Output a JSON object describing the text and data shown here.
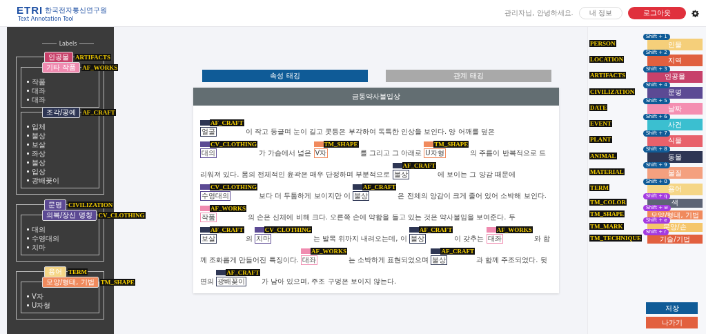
{
  "header": {
    "logo": "ETRI",
    "logo_sub": "한국전자통신연구원",
    "app_name": "Text Annotation Tool",
    "greeting": "관리자님, 안녕하세요.",
    "buttons": [
      {
        "label": "내 정보",
        "kind": "outline"
      },
      {
        "label": "로그아웃",
        "kind": "danger"
      }
    ]
  },
  "sidebar": {
    "heading": "Labels",
    "groups": [
      {
        "label": "인공물",
        "tag": "ARTIFACTS",
        "color": "#c7416a",
        "children": [
          {
            "label": "기타 작품",
            "tag": "AF_WORKS",
            "color": "#f08bb0",
            "items": [
              "작품",
              "대좌",
              "대좌"
            ]
          },
          {
            "label": "조각/공예",
            "tag": "AF_CRAFT",
            "color": "#2e3654",
            "items": [
              "입체",
              "불상",
              "보살",
              "좌상",
              "불상",
              "입상",
              "광배꽂이"
            ]
          }
        ]
      },
      {
        "label": "문명",
        "tag": "CIVILIZATION",
        "color": "#5c4a94",
        "children": [
          {
            "label": "의복/장신 명칭",
            "tag": "CV_CLOTHING",
            "color": "#5c4a94",
            "items": [
              "대의",
              "수영대의",
              "치마"
            ]
          }
        ]
      },
      {
        "label": "용어",
        "tag": "TERM",
        "color": "#f5d687",
        "children": [
          {
            "label": "모양/형태, 기법",
            "tag": "TM_SHAPE",
            "color": "#f08a5d",
            "items": [
              "V자",
              "U자형"
            ]
          }
        ]
      }
    ]
  },
  "tabs": [
    {
      "label": "속성 태깅",
      "selected": true
    },
    {
      "label": "관계 태깅",
      "selected": false
    }
  ],
  "document": {
    "title": "금동약사불입상",
    "segments": [
      {
        "text": "얼굴",
        "tag": "AF_CRAFT",
        "color": "#2e3654"
      },
      {
        "text": "이 작고 둥글며 눈이 길고 콧등은 부각하여 독특한 인상을 보인다. 양 어깨를 덮은 "
      },
      {
        "text": "대의",
        "tag": "CV_CLOTHING",
        "color": "#5c4a94"
      },
      {
        "text": "가 가슴에서 넓은 "
      },
      {
        "text": "V자",
        "tag": "TM_SHAPE",
        "color": "#f08a5d"
      },
      {
        "text": "를 그리고 그 아래로 "
      },
      {
        "text": "U자형",
        "tag": "TM_SHAPE",
        "color": "#f08a5d"
      },
      {
        "text": "의 주름이 반복적으로 드리워져 있다. 몸의 전체적인 윤곽은 매우 단정하며 부분적으로 "
      },
      {
        "text": "불상",
        "tag": "AF_CRAFT",
        "color": "#2e3654"
      },
      {
        "text": "에 보이는 그 양감 때문에 "
      },
      {
        "text": "수영대의",
        "tag": "CV_CLOTHING",
        "color": "#5c4a94"
      },
      {
        "text": "보다 더 두툼하게 보이지만 이 "
      },
      {
        "text": "불상",
        "tag": "AF_CRAFT",
        "color": "#2e3654"
      },
      {
        "text": "은 전체의 양감이 크게 줄어 있어 소박해 보인다. "
      },
      {
        "text": "작품",
        "tag": "AF_WORKS",
        "color": "#f08bb0"
      },
      {
        "text": "의 손은 신체에 비해 크다. 오른쪽 손에 약함을 들고 있는 것은 약사불임을 보여준다. 두 "
      },
      {
        "text": "보살",
        "tag": "AF_CRAFT",
        "color": "#2e3654"
      },
      {
        "text": "의 "
      },
      {
        "text": "치마",
        "tag": "CV_CLOTHING",
        "color": "#5c4a94"
      },
      {
        "text": "는 발목 위까지 내려오는데, 이 "
      },
      {
        "text": "불상",
        "tag": "AF_CRAFT",
        "color": "#2e3654"
      },
      {
        "text": "이 갖추는 "
      },
      {
        "text": "대좌",
        "tag": "AF_WORKS",
        "color": "#f08bb0"
      },
      {
        "text": "와 함께 조화롭게 만들어진 특징이다. "
      },
      {
        "text": "대좌",
        "tag": "AF_WORKS",
        "color": "#f08bb0"
      },
      {
        "text": "는 소박하게 표현되었으며 "
      },
      {
        "text": "불상",
        "tag": "AF_CRAFT",
        "color": "#2e3654"
      },
      {
        "text": "과 함께 주조되었다. 뒷면의 "
      },
      {
        "text": "광배꽂이",
        "tag": "AF_CRAFT",
        "color": "#2e3654"
      },
      {
        "text": "가 남아 있으며, 주조 구멍은 보이지 않는다."
      }
    ]
  },
  "labels": [
    {
      "tag": "PERSON",
      "shortcut": "Shift + 1",
      "name": "인물",
      "color": "#f5cf7a",
      "kind": "main"
    },
    {
      "tag": "LOCATION",
      "shortcut": "Shift + 2",
      "name": "지역",
      "color": "#e0603f",
      "kind": "main"
    },
    {
      "tag": "ARTIFACTS",
      "shortcut": "Shift + 3",
      "name": "인공물",
      "color": "#c7416a",
      "kind": "main"
    },
    {
      "tag": "CIVILIZATION",
      "shortcut": "Shift + 4",
      "name": "문명",
      "color": "#5c4a94",
      "kind": "main"
    },
    {
      "tag": "DATE",
      "shortcut": "Shift + 5",
      "name": "날짜",
      "color": "#f48fb1",
      "kind": "main"
    },
    {
      "tag": "EVENT",
      "shortcut": "Shift + 6",
      "name": "사건",
      "color": "#3bbfd0",
      "kind": "main"
    },
    {
      "tag": "PLANT",
      "shortcut": "Shift + 7",
      "name": "식물",
      "color": "#e8616b",
      "kind": "main"
    },
    {
      "tag": "ANIMAL",
      "shortcut": "Shift + 8",
      "name": "동물",
      "color": "#2e3654",
      "kind": "main"
    },
    {
      "tag": "MATERIAL",
      "shortcut": "Shift + 9",
      "name": "물질",
      "color": "#f4a07f",
      "kind": "main"
    },
    {
      "tag": "TERM",
      "shortcut": "Shift + 0",
      "name": "용어",
      "color": "#f5d687",
      "kind": "main"
    },
    {
      "tag": "TM_COLOR",
      "shortcut": "Shift + q",
      "name": "색",
      "color": "#5d6475",
      "kind": "sub"
    },
    {
      "tag": "TM_SHAPE",
      "shortcut": "Shift + w",
      "name": "모양/형태, 기법",
      "color": "#f08a5d",
      "kind": "sub"
    },
    {
      "tag": "TM_MARK",
      "shortcut": "Shift + e",
      "name": "문양/손",
      "color": "#f5c66b",
      "kind": "sub"
    },
    {
      "tag": "TM_TECHNIQUE",
      "shortcut": "Shift + r",
      "name": "기술/기법",
      "color": "#e2603f",
      "kind": "sub"
    }
  ],
  "actions": [
    {
      "label": "저장",
      "kind": "primary"
    },
    {
      "label": "나가기",
      "kind": "secondary"
    }
  ]
}
